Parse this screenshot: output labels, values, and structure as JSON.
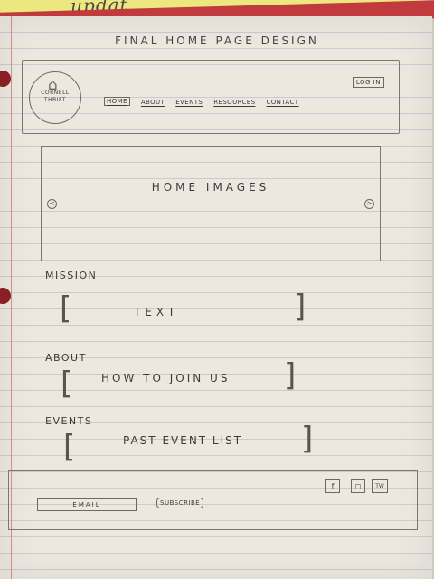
{
  "note": {
    "text": "updat"
  },
  "page_title": "FINAL HOME PAGE DESIGN",
  "header": {
    "logo_text_line1": "CORNELL",
    "logo_text_line2": "THRIFT",
    "login_label": "LOG IN",
    "nav": [
      {
        "label": "HOME",
        "active": true
      },
      {
        "label": "ABOUT"
      },
      {
        "label": "EVENTS"
      },
      {
        "label": "RESOURCES"
      },
      {
        "label": "CONTACT"
      }
    ]
  },
  "carousel": {
    "label": "HOME IMAGES",
    "prev_glyph": "<",
    "next_glyph": ">"
  },
  "sections": {
    "mission": {
      "heading": "MISSION",
      "placeholder": "TEXT"
    },
    "about": {
      "heading": "ABOUT",
      "placeholder": "HOW TO JOIN US"
    },
    "events": {
      "heading": "EVENTS",
      "placeholder": "PAST EVENT LIST"
    }
  },
  "footer": {
    "social": [
      {
        "name": "facebook-icon",
        "glyph": "f"
      },
      {
        "name": "instagram-icon",
        "glyph": "◻"
      },
      {
        "name": "twitter-icon",
        "glyph": "TW"
      }
    ],
    "email_placeholder": "EMAIL",
    "subscribe_label": "SUBSCRIBE"
  }
}
